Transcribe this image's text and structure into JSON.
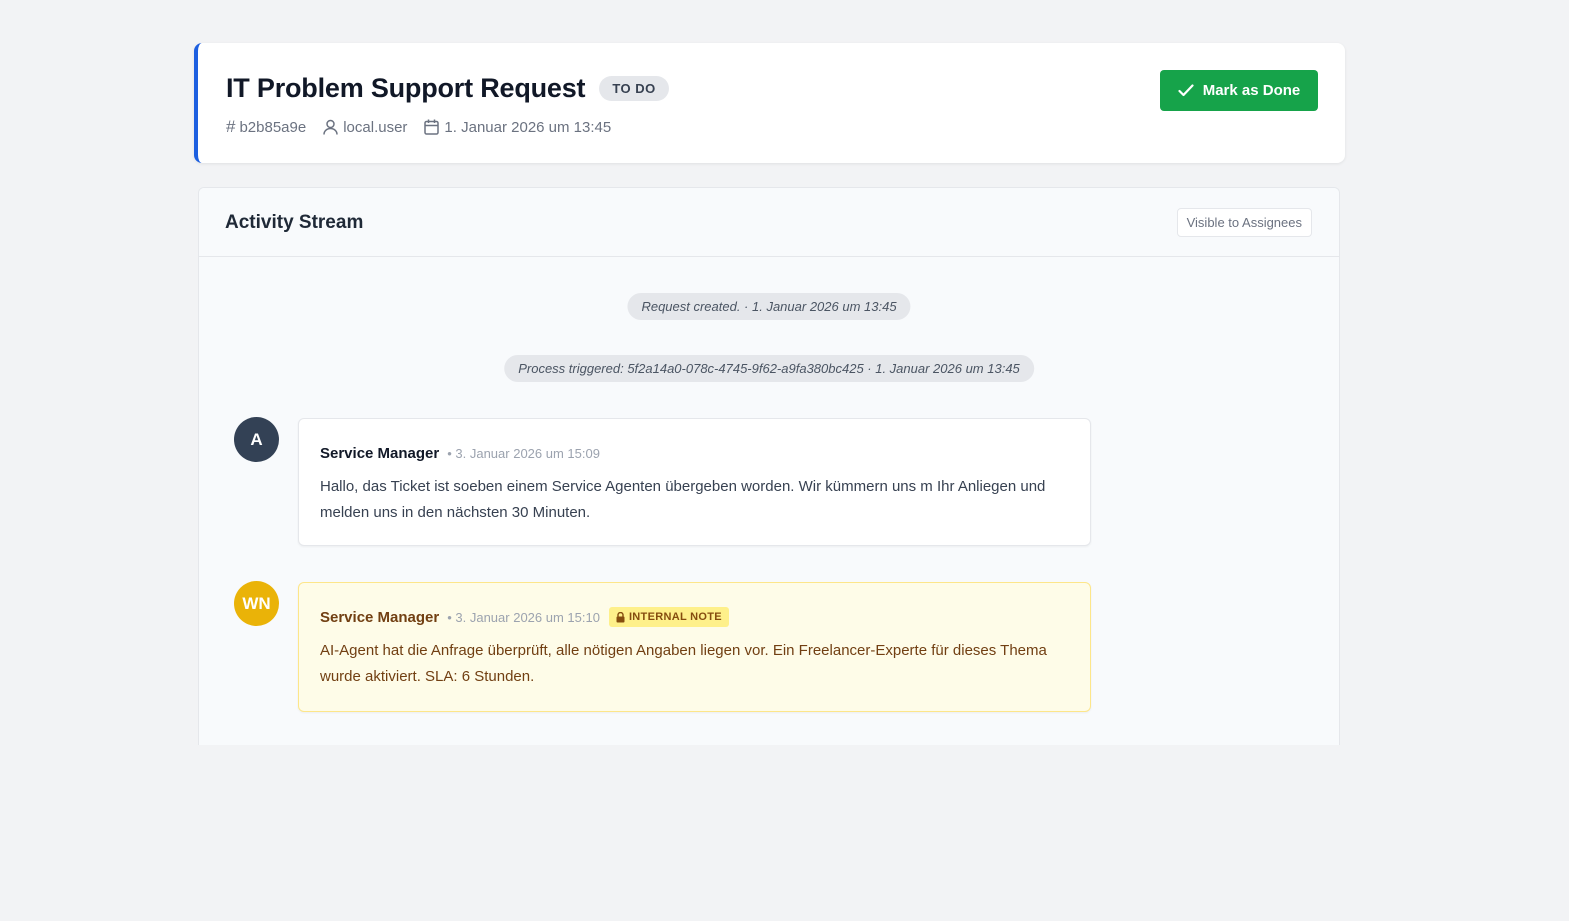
{
  "header": {
    "title": "IT Problem Support Request",
    "status": "TO DO",
    "ticket_id": "b2b85a9e",
    "user": "local.user",
    "created": "1. Januar 2026 um 13:45",
    "done_label": "Mark as Done"
  },
  "activity": {
    "title": "Activity Stream",
    "visibility": "Visible to Assignees",
    "events": [
      {
        "text": "Request created. · 1. Januar 2026 um 13:45"
      },
      {
        "text": "Process triggered: 5f2a14a0-078c-4745-9f62-a9fa380bc425 · 1. Januar 2026 um 13:45"
      }
    ],
    "messages": [
      {
        "avatar": "A",
        "avatar_color": "#334155",
        "author": "Service Manager",
        "time": "• 3. Januar 2026 um 15:09",
        "body": "Hallo, das Ticket ist soeben einem Service Agenten übergeben worden. Wir kümmern uns m Ihr Anliegen und melden uns in den nächsten 30 Minuten."
      },
      {
        "avatar": "WN",
        "avatar_color": "#eab308",
        "author": "Service Manager",
        "time": "• 3. Januar 2026 um 15:10",
        "badge": "INTERNAL NOTE",
        "body": "AI-Agent hat die Anfrage überprüft, alle nötigen Angaben liegen vor. Ein Freelancer-Experte für dieses Thema wurde aktiviert. SLA: 6 Stunden."
      }
    ]
  },
  "colors": {
    "accent": "#1d5fe0",
    "done_button": "#16a34a",
    "internal_bg": "#fefce8"
  }
}
